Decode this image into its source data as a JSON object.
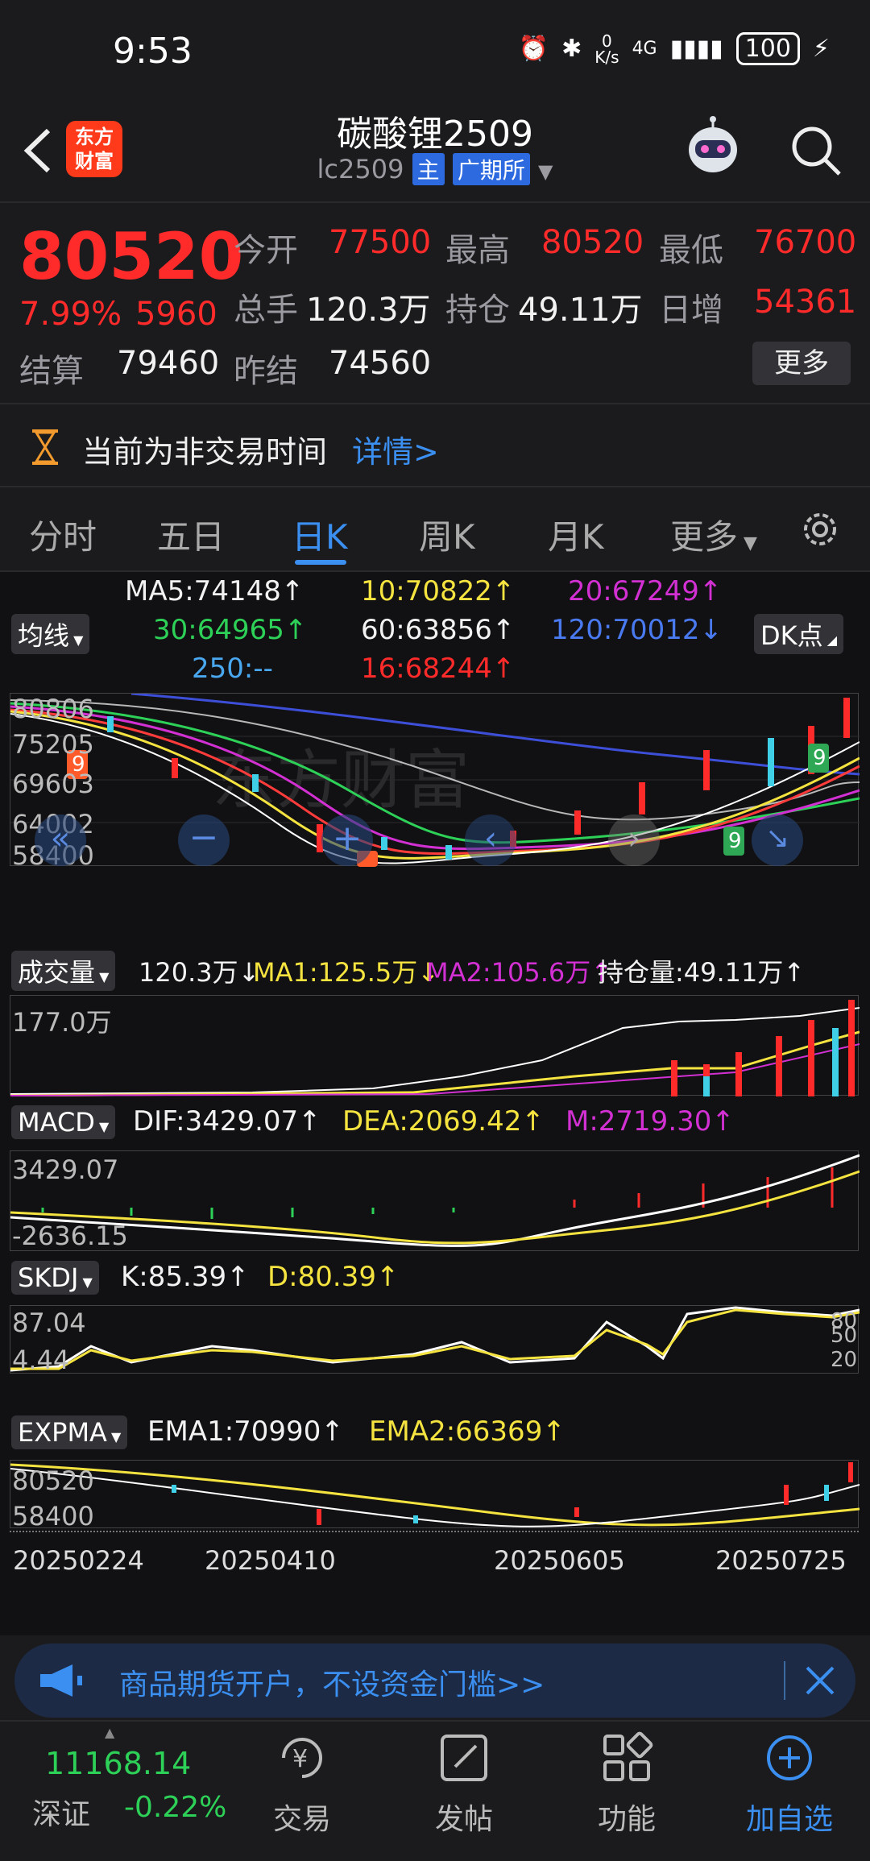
{
  "status_bar": {
    "time": "9:53",
    "net_speed": "0\nK/s",
    "network": "4G",
    "battery": "100"
  },
  "header": {
    "logo_text": "东方\n财富",
    "title": "碳酸锂2509",
    "code": "lc2509",
    "tag_main": "主",
    "tag_exchange": "广期所"
  },
  "quote": {
    "price": "80520",
    "change_pct": "7.99%",
    "change": "5960",
    "open_label": "今开",
    "open": "77500",
    "high_label": "最高",
    "high": "80520",
    "low_label": "最低",
    "low": "76700",
    "volume_label": "总手",
    "volume": "120.3万",
    "oi_label": "持仓",
    "oi": "49.11万",
    "daily_inc_label": "日增",
    "daily_inc": "54361",
    "settle_label": "结算",
    "settle": "79460",
    "prev_settle_label": "昨结",
    "prev_settle": "74560",
    "more_label": "更多"
  },
  "notice": {
    "text": "当前为非交易时间",
    "link": "详情>"
  },
  "tabs": [
    "分时",
    "五日",
    "日K",
    "周K",
    "月K",
    "更多"
  ],
  "active_tab": 2,
  "chart": {
    "ma_button": "均线",
    "dk_button": "DK点",
    "ma5": "MA5:74148↑",
    "ma10": "10:70822↑",
    "ma20": "20:67249↑",
    "ma30": "30:64965↑",
    "ma60": "60:63856↑",
    "ma120": "120:70012↓",
    "ma250": "250:--",
    "ma16": "16:68244↑",
    "price_axis": [
      "80806",
      "75205",
      "69603",
      "64002",
      "58400"
    ],
    "vol_button": "成交量",
    "vol_value": "120.3万↓",
    "vol_ma1": "MA1:125.5万↓",
    "vol_ma2": "MA2:105.6万↑",
    "vol_oi": "持仓量:49.11万↑",
    "vol_axis": "177.0万",
    "macd_button": "MACD",
    "macd_dif": "DIF:3429.07↑",
    "macd_dea": "DEA:2069.42↑",
    "macd_m": "M:2719.30↑",
    "macd_axis_top": "3429.07",
    "macd_axis_bot": "-2636.15",
    "skdj_button": "SKDJ",
    "skdj_k": "K:85.39↑",
    "skdj_d": "D:80.39↑",
    "skdj_axis_top": "87.04",
    "skdj_axis_bot": "4.44",
    "skdj_levels": [
      "80",
      "50",
      "20"
    ],
    "expma_button": "EXPMA",
    "expma_ema1": "EMA1:70990↑",
    "expma_ema2": "EMA2:66369↑",
    "expma_axis_top": "80520",
    "expma_axis_bot": "58400",
    "dates": [
      "20250224",
      "20250410",
      "20250605",
      "20250725"
    ],
    "watermark": "东方财富"
  },
  "ad": {
    "text": "商品期货开户，不设资金门槛>>"
  },
  "bottom_nav": {
    "index_value": "11168.14",
    "index_name": "深证",
    "index_change": "-0.22%",
    "items": [
      "交易",
      "发帖",
      "功能",
      "加自选"
    ]
  },
  "colors": {
    "up": "#ff2b2b",
    "down": "#2ed158",
    "accent": "#3b8ff0",
    "bg": "#1b1b1d"
  }
}
